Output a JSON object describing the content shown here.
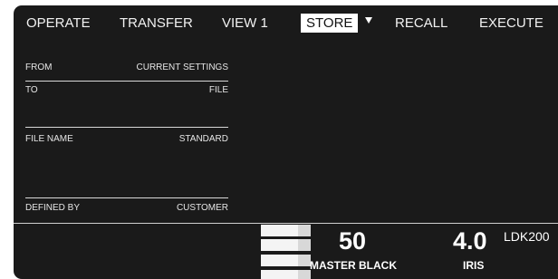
{
  "menu": {
    "items": [
      "OPERATE",
      "TRANSFER",
      "VIEW 1",
      "STORE",
      "RECALL",
      "EXECUTE"
    ],
    "selected": "STORE"
  },
  "store_form": {
    "from_label": "FROM",
    "from_value": "CURRENT SETTINGS",
    "to_label": "TO",
    "to_value": "FILE",
    "file_name_label": "FILE NAME",
    "file_name_value": "STANDARD",
    "defined_by_label": "DEFINED BY",
    "defined_by_value": "CUSTOMER"
  },
  "status": {
    "master_black_value": "50",
    "master_black_label": "MASTER BLACK",
    "iris_value": "4.0",
    "iris_label": "IRIS",
    "model": "LDK200"
  },
  "colors": {
    "background": "#1a1a1a",
    "text": "#f2f2f2",
    "selected_bg": "#ffffff",
    "selected_text": "#111111"
  }
}
